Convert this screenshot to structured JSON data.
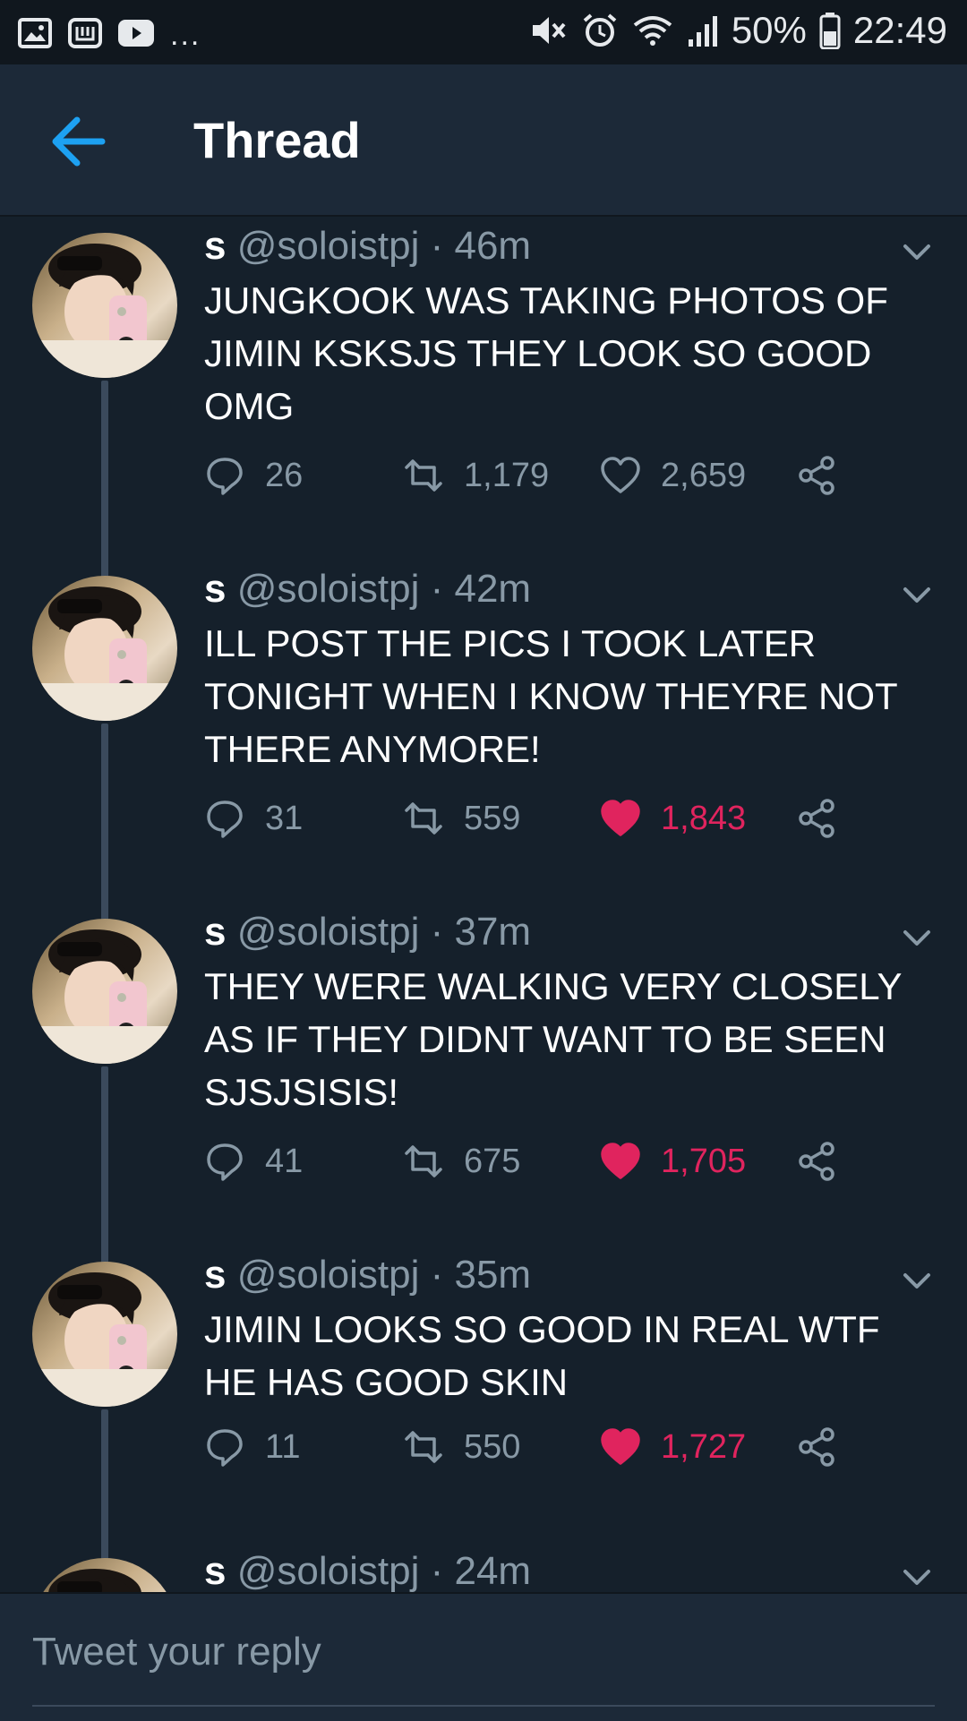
{
  "status_bar": {
    "left_icons": [
      "image-icon",
      "app-icon",
      "youtube-icon"
    ],
    "overflow": "...",
    "battery": "50%",
    "time": "22:49"
  },
  "header": {
    "title": "Thread"
  },
  "tweets": [
    {
      "name": "s",
      "handle": "@soloistpj",
      "time": "· 46m",
      "text": "JUNGKOOK WAS TAKING PHOTOS OF JIMIN KSKSJS THEY LOOK SO GOOD OMG",
      "replies": "26",
      "retweets": "1,179",
      "likes": "2,659",
      "liked": false
    },
    {
      "name": "s",
      "handle": "@soloistpj",
      "time": "· 42m",
      "text": "ILL POST THE PICS I TOOK LATER TONIGHT WHEN I KNOW THEYRE NOT THERE ANYMORE!",
      "replies": "31",
      "retweets": "559",
      "likes": "1,843",
      "liked": true
    },
    {
      "name": "s",
      "handle": "@soloistpj",
      "time": "· 37m",
      "text": "THEY WERE WALKING VERY CLOSELY AS IF THEY DIDNT WANT TO BE SEEN SJSJSISIS!",
      "replies": "41",
      "retweets": "675",
      "likes": "1,705",
      "liked": true
    },
    {
      "name": "s",
      "handle": "@soloistpj",
      "time": "· 35m",
      "text": "JIMIN LOOKS SO GOOD IN REAL WTF HE HAS GOOD SKIN",
      "replies": "11",
      "retweets": "550",
      "likes": "1,727",
      "liked": true
    },
    {
      "name": "s",
      "handle": "@soloistpj",
      "time": "· 24m"
    }
  ],
  "reply": {
    "placeholder": "Tweet your reply"
  },
  "colors": {
    "background": "#15202b",
    "header": "#1c2938",
    "accent": "#1da1f2",
    "like": "#e0245e",
    "muted": "#8899a6"
  }
}
